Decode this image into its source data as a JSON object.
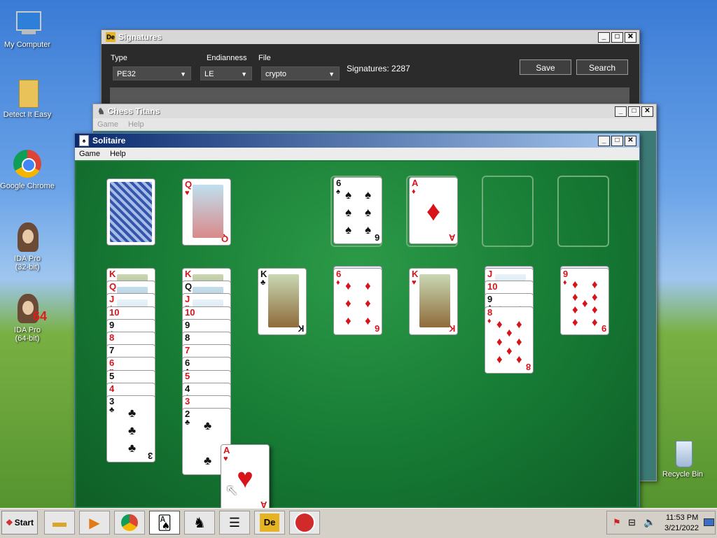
{
  "desktop": {
    "icons": [
      {
        "label": "My Computer",
        "icon": "computer-icon"
      },
      {
        "label": "Detect It Easy",
        "icon": "folder-icon"
      },
      {
        "label": "Google Chrome",
        "icon": "chrome-icon"
      },
      {
        "label": "IDA Pro\n(32-bit)",
        "icon": "ida-icon"
      },
      {
        "label": "IDA Pro\n(64-bit)",
        "icon": "ida64-icon",
        "badge": "64"
      },
      {
        "label": "Recycle Bin",
        "icon": "recycle-bin-icon"
      }
    ]
  },
  "signatures": {
    "title": "Signatures",
    "type_label": "Type",
    "type_value": "PE32",
    "endianness_label": "Endianness",
    "endianness_value": "LE",
    "file_label": "File",
    "file_value": "crypto",
    "signatures_count": "Signatures: 2287",
    "save_label": "Save",
    "search_label": "Search"
  },
  "chess": {
    "title": "Chess Titans",
    "menu": [
      "Game",
      "Help"
    ]
  },
  "solitaire": {
    "title": "Solitaire",
    "menu": [
      "Game",
      "Help"
    ],
    "waste": {
      "rank": "Q",
      "suit": "♥"
    },
    "foundations": [
      {
        "rank": "6",
        "suit": "♠"
      },
      {
        "rank": "A",
        "suit": "♦"
      }
    ],
    "tableau": [
      {
        "cards": [
          [
            "K",
            "♦"
          ],
          [
            "Q",
            "♦"
          ],
          [
            "J",
            "♦"
          ],
          [
            "10",
            "♥"
          ],
          [
            "9",
            "♣"
          ],
          [
            "8",
            "♥"
          ],
          [
            "7",
            "♠"
          ],
          [
            "6",
            "♥"
          ],
          [
            "5",
            "♣"
          ],
          [
            "4",
            "♥"
          ],
          [
            "3",
            "♣"
          ]
        ]
      },
      {
        "cards": [
          [
            "K",
            "♥"
          ],
          [
            "Q",
            "♠"
          ],
          [
            "J",
            "♥"
          ],
          [
            "10",
            "♥"
          ],
          [
            "9",
            "♠"
          ],
          [
            "8",
            "♠"
          ],
          [
            "7",
            "♥"
          ],
          [
            "6",
            "♣"
          ],
          [
            "5",
            "♥"
          ],
          [
            "4",
            "♣"
          ],
          [
            "3",
            "♥"
          ],
          [
            "2",
            "♣"
          ]
        ]
      },
      {
        "cards": [
          [
            "K",
            "♣"
          ]
        ]
      },
      {
        "cards": [
          [
            "6",
            "♦"
          ]
        ]
      },
      {
        "cards": [
          [
            "K",
            "♥"
          ]
        ]
      },
      {
        "cards": [
          [
            "J",
            "♦"
          ],
          [
            "10",
            "♥"
          ],
          [
            "9",
            "♣"
          ],
          [
            "8",
            "♦"
          ]
        ]
      },
      {
        "cards": [
          [
            "9",
            "♦"
          ]
        ]
      }
    ],
    "dragged_card": {
      "rank": "A",
      "suit": "♥"
    }
  },
  "taskbar": {
    "start_label": "Start",
    "time": "11:53 PM",
    "date": "3/21/2022"
  }
}
